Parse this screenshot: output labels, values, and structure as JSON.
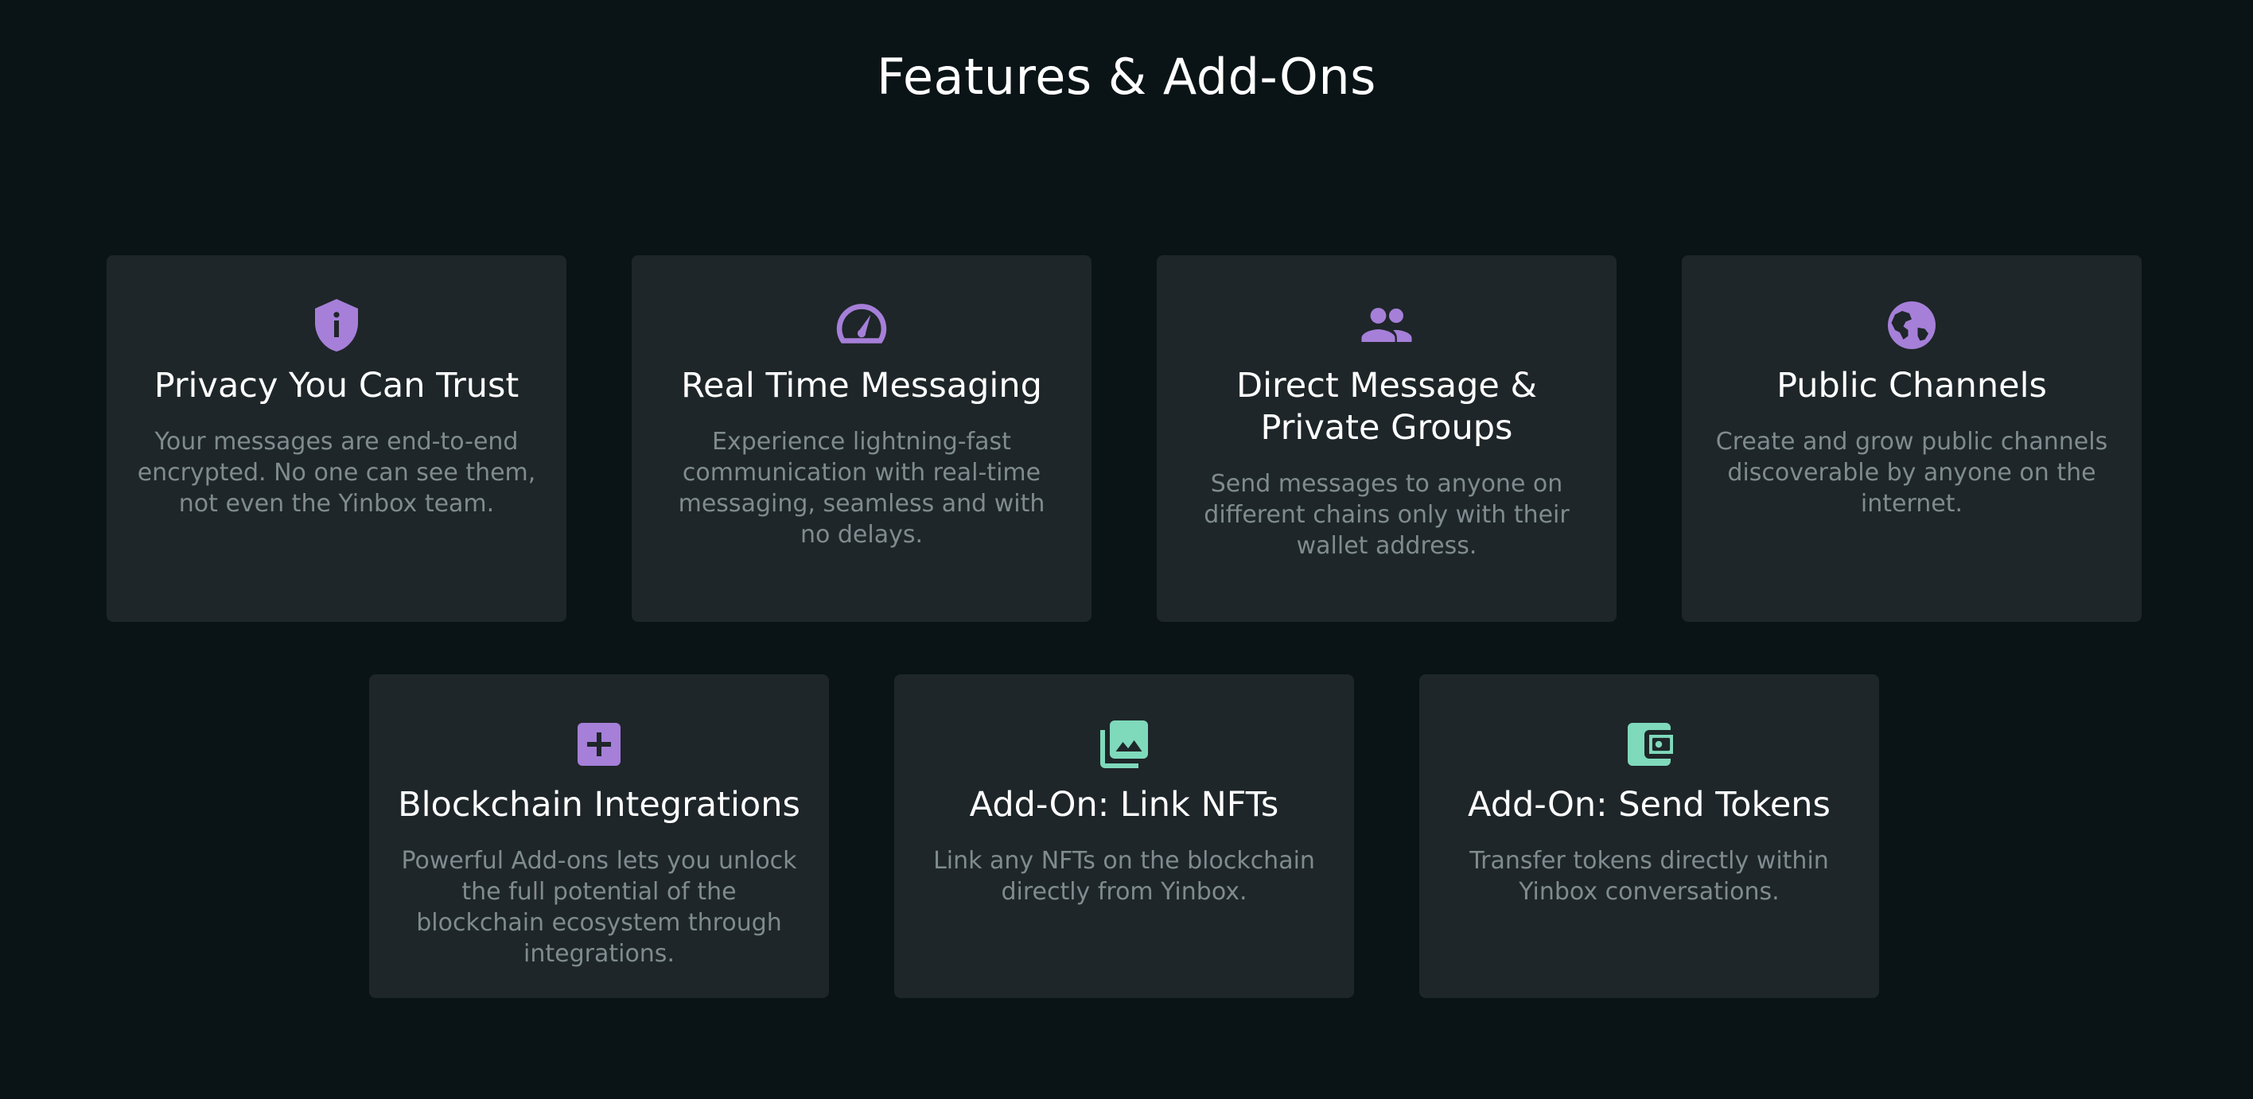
{
  "page": {
    "title": "Features & Add-Ons"
  },
  "colors": {
    "background": "#0a1417",
    "card": "#1e2629",
    "purple_icon": "#a67fd9",
    "green_icon": "#7fd9bb",
    "title_text": "#ffffff",
    "desc_text": "#7f8b8f"
  },
  "features": [
    {
      "icon": "shield-info-icon",
      "title": "Privacy You Can Trust",
      "description": "Your messages are end-to-end encrypted. No one can see them, not even the Yinbox team."
    },
    {
      "icon": "speedometer-icon",
      "title": "Real Time Messaging",
      "description": "Experience lightning-fast communication with real-time messaging, seamless and with no delays."
    },
    {
      "icon": "people-icon",
      "title": "Direct Message & Private Groups",
      "description": "Send messages to anyone on different chains only with their wallet address."
    },
    {
      "icon": "globe-icon",
      "title": "Public Channels",
      "description": "Create and grow public channels discoverable by anyone on the internet."
    },
    {
      "icon": "plus-box-icon",
      "title": "Blockchain Integrations",
      "description": "Powerful Add-ons lets you unlock the full potential of the blockchain ecosystem through integrations."
    },
    {
      "icon": "image-gallery-icon",
      "title": "Add-On: Link NFTs",
      "description": "Link any NFTs on the blockchain directly from Yinbox."
    },
    {
      "icon": "wallet-icon",
      "title": "Add-On: Send Tokens",
      "description": "Transfer tokens directly within Yinbox conversations."
    }
  ]
}
